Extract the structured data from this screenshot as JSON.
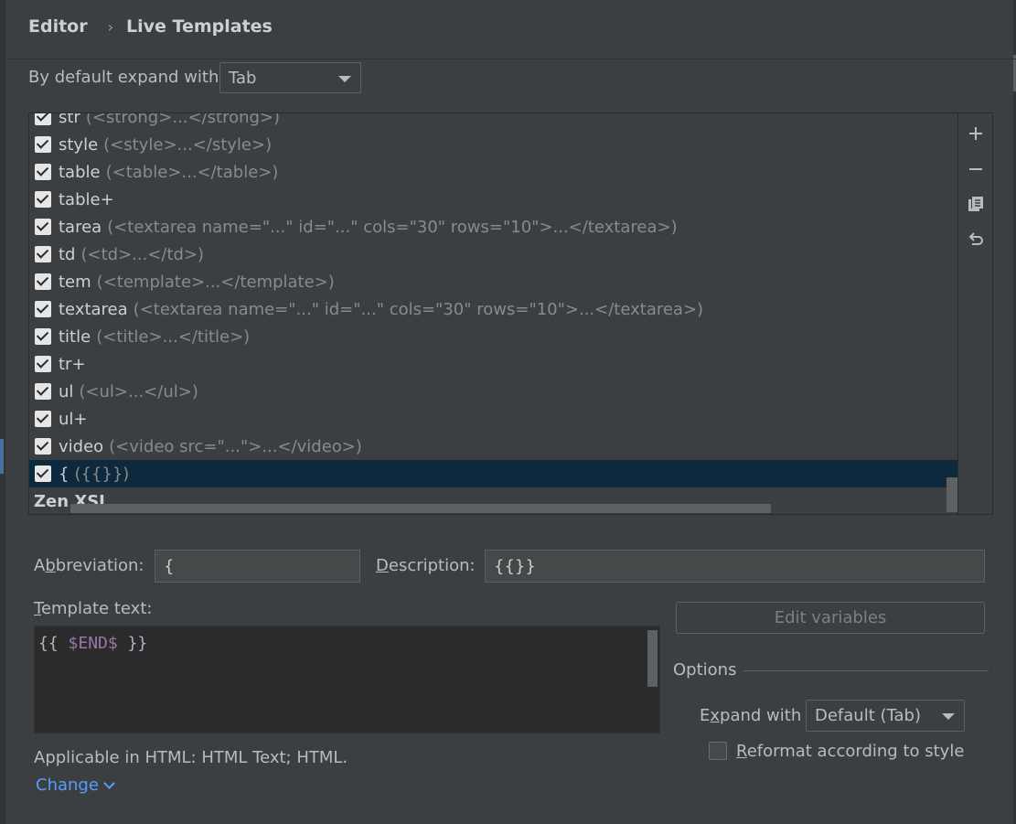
{
  "breadcrumb": {
    "root": "Editor",
    "current": "Live Templates"
  },
  "expand": {
    "label": "By default expand with",
    "value": "Tab"
  },
  "templates": [
    {
      "abbr": "str",
      "desc": "(<strong>...</strong>)"
    },
    {
      "abbr": "style",
      "desc": "(<style>...</style>)"
    },
    {
      "abbr": "table",
      "desc": "(<table>...</table>)"
    },
    {
      "abbr": "table+",
      "desc": ""
    },
    {
      "abbr": "tarea",
      "desc": "(<textarea name=\"...\" id=\"...\" cols=\"30\" rows=\"10\">...</textarea>)"
    },
    {
      "abbr": "td",
      "desc": "(<td>...</td>)"
    },
    {
      "abbr": "tem",
      "desc": "(<template>...</template>)"
    },
    {
      "abbr": "textarea",
      "desc": "(<textarea name=\"...\" id=\"...\" cols=\"30\" rows=\"10\">...</textarea>)"
    },
    {
      "abbr": "title",
      "desc": "(<title>...</title>)"
    },
    {
      "abbr": "tr+",
      "desc": ""
    },
    {
      "abbr": "ul",
      "desc": "(<ul>...</ul>)"
    },
    {
      "abbr": "ul+",
      "desc": ""
    },
    {
      "abbr": "video",
      "desc": "(<video src=\"...\">...</video>)"
    },
    {
      "abbr": "{",
      "desc": "({{}})"
    }
  ],
  "group_name": "Zen XSL",
  "abbreviation": {
    "label_pre": "A",
    "label_ul": "b",
    "label_post": "breviation:",
    "value": "{"
  },
  "description": {
    "label_ul": "D",
    "label_post": "escription:",
    "value": "{{}}"
  },
  "template_text": {
    "label_ul": "T",
    "label_post": "emplate text:",
    "code_pre": "{{ ",
    "code_var": "$END$",
    "code_post": " }}"
  },
  "edit_variables_label": "Edit variables",
  "options": {
    "title": "Options",
    "expand_label_pre": "E",
    "expand_label_ul": "x",
    "expand_label_post": "pand with",
    "expand_value": "Default (Tab)",
    "reformat_ul": "R",
    "reformat_post": "eformat according to style"
  },
  "applicable_text": "Applicable in HTML: HTML Text; HTML.",
  "change_label": "Change",
  "icons": {
    "add": "plus-icon",
    "remove": "minus-icon",
    "copy": "copy-icon",
    "restore": "undo-icon"
  }
}
